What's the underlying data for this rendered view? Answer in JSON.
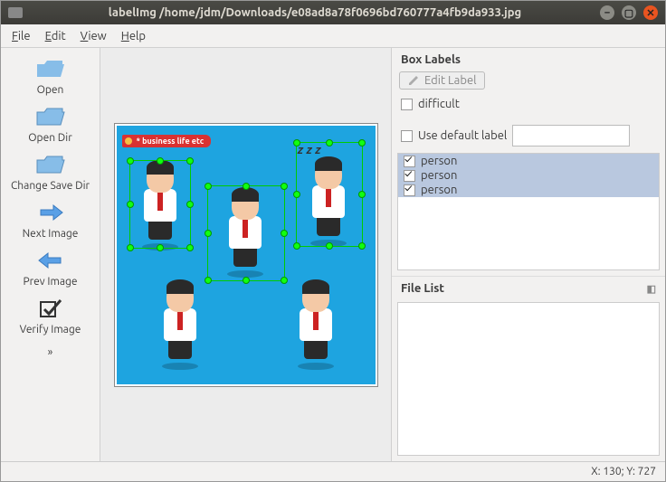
{
  "titlebar": {
    "title": "labelImg /home/jdm/Downloads/e08ad8a78f0696bd760777a4fb9da933.jpg"
  },
  "menu": {
    "file": "File",
    "edit": "Edit",
    "view": "View",
    "help": "Help"
  },
  "toolbar": {
    "open": "Open",
    "open_dir": "Open Dir",
    "change_save_dir": "Change Save Dir",
    "next_image": "Next Image",
    "prev_image": "Prev Image",
    "verify_image": "Verify Image"
  },
  "canvas": {
    "ribbon": "* business life etc",
    "sleep_text": "z z z"
  },
  "panel": {
    "box_labels": "Box Labels",
    "edit_label": "Edit Label",
    "difficult": "difficult",
    "use_default": "Use default label",
    "default_value": "",
    "labels": [
      "person",
      "person",
      "person"
    ],
    "file_list": "File List"
  },
  "status": {
    "coords": "X: 130; Y: 727"
  }
}
